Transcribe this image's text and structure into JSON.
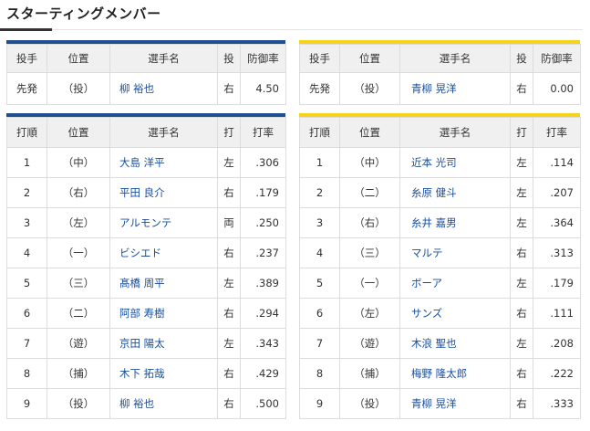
{
  "heading": "スターティングメンバー",
  "colors": {
    "home_accent": "#1d4f91",
    "away_accent": "#f5d31c",
    "name_link": "#1a4f9c"
  },
  "pitcher_headers": [
    "投手",
    "位置",
    "選手名",
    "投",
    "防御率"
  ],
  "batting_headers": [
    "打順",
    "位置",
    "選手名",
    "打",
    "打率"
  ],
  "home": {
    "pitcher": {
      "role": "先発",
      "pos": "（投）",
      "name": "柳 裕也",
      "hand": "右",
      "era": "4.50"
    },
    "batting": [
      {
        "order": "1",
        "pos": "（中）",
        "name": "大島 洋平",
        "hand": "左",
        "avg": ".306"
      },
      {
        "order": "2",
        "pos": "（右）",
        "name": "平田 良介",
        "hand": "右",
        "avg": ".179"
      },
      {
        "order": "3",
        "pos": "（左）",
        "name": "アルモンテ",
        "hand": "両",
        "avg": ".250"
      },
      {
        "order": "4",
        "pos": "（一）",
        "name": "ビシエド",
        "hand": "右",
        "avg": ".237"
      },
      {
        "order": "5",
        "pos": "（三）",
        "name": "髙橋 周平",
        "hand": "左",
        "avg": ".389"
      },
      {
        "order": "6",
        "pos": "（二）",
        "name": "阿部 寿樹",
        "hand": "右",
        "avg": ".294"
      },
      {
        "order": "7",
        "pos": "（遊）",
        "name": "京田 陽太",
        "hand": "左",
        "avg": ".343"
      },
      {
        "order": "8",
        "pos": "（捕）",
        "name": "木下 拓哉",
        "hand": "右",
        "avg": ".429"
      },
      {
        "order": "9",
        "pos": "（投）",
        "name": "柳 裕也",
        "hand": "右",
        "avg": ".500"
      }
    ]
  },
  "away": {
    "pitcher": {
      "role": "先発",
      "pos": "（投）",
      "name": "青柳 晃洋",
      "hand": "右",
      "era": "0.00"
    },
    "batting": [
      {
        "order": "1",
        "pos": "（中）",
        "name": "近本 光司",
        "hand": "左",
        "avg": ".114"
      },
      {
        "order": "2",
        "pos": "（二）",
        "name": "糸原 健斗",
        "hand": "左",
        "avg": ".207"
      },
      {
        "order": "3",
        "pos": "（右）",
        "name": "糸井 嘉男",
        "hand": "左",
        "avg": ".364"
      },
      {
        "order": "4",
        "pos": "（三）",
        "name": "マルテ",
        "hand": "右",
        "avg": ".313"
      },
      {
        "order": "5",
        "pos": "（一）",
        "name": "ボーア",
        "hand": "左",
        "avg": ".179"
      },
      {
        "order": "6",
        "pos": "（左）",
        "name": "サンズ",
        "hand": "右",
        "avg": ".111"
      },
      {
        "order": "7",
        "pos": "（遊）",
        "name": "木浪 聖也",
        "hand": "左",
        "avg": ".208"
      },
      {
        "order": "8",
        "pos": "（捕）",
        "name": "梅野 隆太郎",
        "hand": "右",
        "avg": ".222"
      },
      {
        "order": "9",
        "pos": "（投）",
        "name": "青柳 晃洋",
        "hand": "右",
        "avg": ".333"
      }
    ]
  }
}
